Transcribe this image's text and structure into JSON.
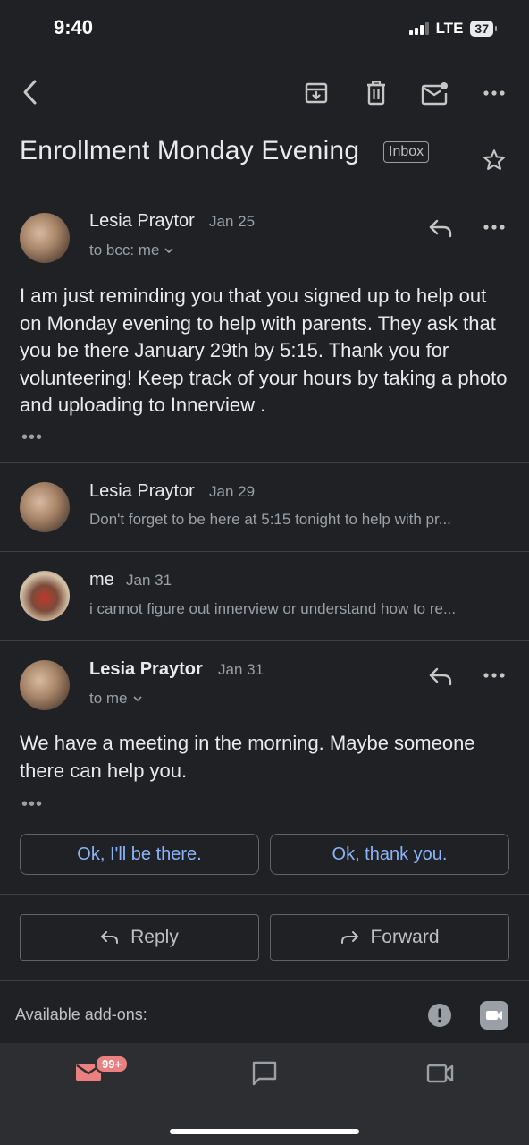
{
  "status_bar": {
    "time": "9:40",
    "network": "LTE",
    "battery": "37"
  },
  "toolbar": {
    "back_icon": "chevron-left-icon",
    "archive_icon": "archive-icon",
    "delete_icon": "trash-icon",
    "mark_unread_icon": "mark-unread-icon",
    "more_icon": "more-horizontal-icon"
  },
  "subject": {
    "title": "Enrollment Monday Evening",
    "label": "Inbox"
  },
  "messages": [
    {
      "sender": "Lesia Praytor",
      "date": "Jan 25",
      "recipients": "to bcc: me",
      "body": "I am just reminding you that you signed up to help out on Monday evening to help with parents. They ask that you be there January 29th by 5:15. Thank you for volunteering! Keep track of your hours by taking a  photo and uploading to Innerview ."
    },
    {
      "sender": "Lesia Praytor",
      "date": "Jan 29",
      "snippet": "Don't forget to be here at 5:15 tonight to help with pr..."
    },
    {
      "sender": "me",
      "date": "Jan 31",
      "snippet": "i cannot figure out innerview or understand how to re..."
    },
    {
      "sender": "Lesia Praytor",
      "date": "Jan 31",
      "recipients": "to me",
      "body": "We have a meeting in the morning. Maybe someone there can help you."
    }
  ],
  "ellipsis": "•••",
  "smart_replies": [
    "Ok, I'll be there.",
    "Ok, thank you."
  ],
  "actions": {
    "reply": "Reply",
    "forward": "Forward"
  },
  "addons": {
    "label": "Available add-ons:"
  },
  "bottom_nav": {
    "mail_badge": "99+",
    "items": [
      "mail-icon",
      "chat-icon",
      "meet-icon"
    ]
  },
  "colors": {
    "background": "#202124",
    "accent_link": "#8ab4f8",
    "badge": "#ea8080"
  }
}
